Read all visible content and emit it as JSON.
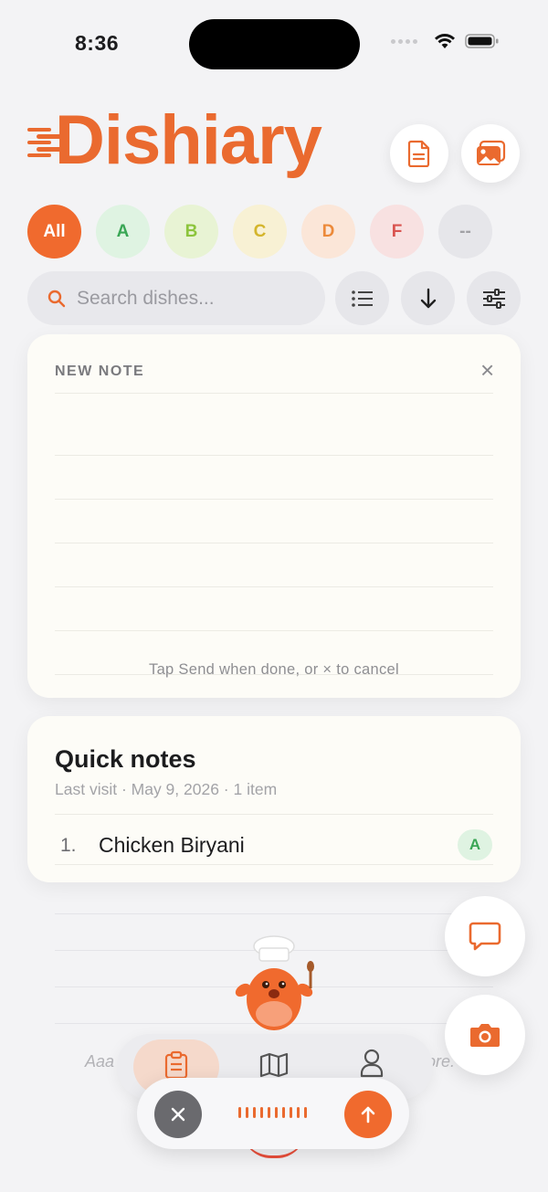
{
  "status": {
    "time": "8:36"
  },
  "app": {
    "name": "Dishiary",
    "brand_color": "#ea6a2f"
  },
  "header": {
    "buttons": [
      {
        "icon": "document-icon"
      },
      {
        "icon": "photo-gallery-icon"
      }
    ]
  },
  "grades": [
    {
      "label": "All",
      "bg": "#f06a2e",
      "fg": "#ffffff",
      "selected": true
    },
    {
      "label": "A",
      "bg": "#dff3e2",
      "fg": "#3aa655"
    },
    {
      "label": "B",
      "bg": "#e8f3d4",
      "fg": "#8cc43c"
    },
    {
      "label": "C",
      "bg": "#f8f1d4",
      "fg": "#d4b52c"
    },
    {
      "label": "D",
      "bg": "#fbe6d8",
      "fg": "#ec8a3a"
    },
    {
      "label": "F",
      "bg": "#f8e1e1",
      "fg": "#d9534f"
    },
    {
      "label": "--",
      "bg": "#e6e6ea",
      "fg": "#a0a0a4"
    }
  ],
  "search": {
    "placeholder": "Search dishes..."
  },
  "tools": [
    {
      "icon": "list-icon"
    },
    {
      "icon": "sort-down-icon"
    },
    {
      "icon": "filter-sliders-icon"
    }
  ],
  "new_note": {
    "title": "NEW NOTE",
    "close": "×",
    "hint": "Tap Send when done, or × to cancel"
  },
  "quick_notes": {
    "title": "Quick notes",
    "subtitle": "Last visit · May 9, 2026 · 1 item",
    "items": [
      {
        "number": "1.",
        "dish": "Chicken Biryani",
        "grade": "A"
      }
    ]
  },
  "background_text": {
    "left": "Aaa",
    "right": "ore."
  },
  "fabs": [
    {
      "icon": "chat-icon"
    },
    {
      "icon": "camera-icon"
    }
  ],
  "tabbar": {
    "tabs": [
      {
        "icon": "clipboard-icon",
        "selected": true
      },
      {
        "icon": "map-icon"
      },
      {
        "icon": "profile-icon"
      }
    ]
  },
  "recorder": {
    "cancel_icon": "close-icon",
    "send_icon": "arrow-up-icon"
  }
}
